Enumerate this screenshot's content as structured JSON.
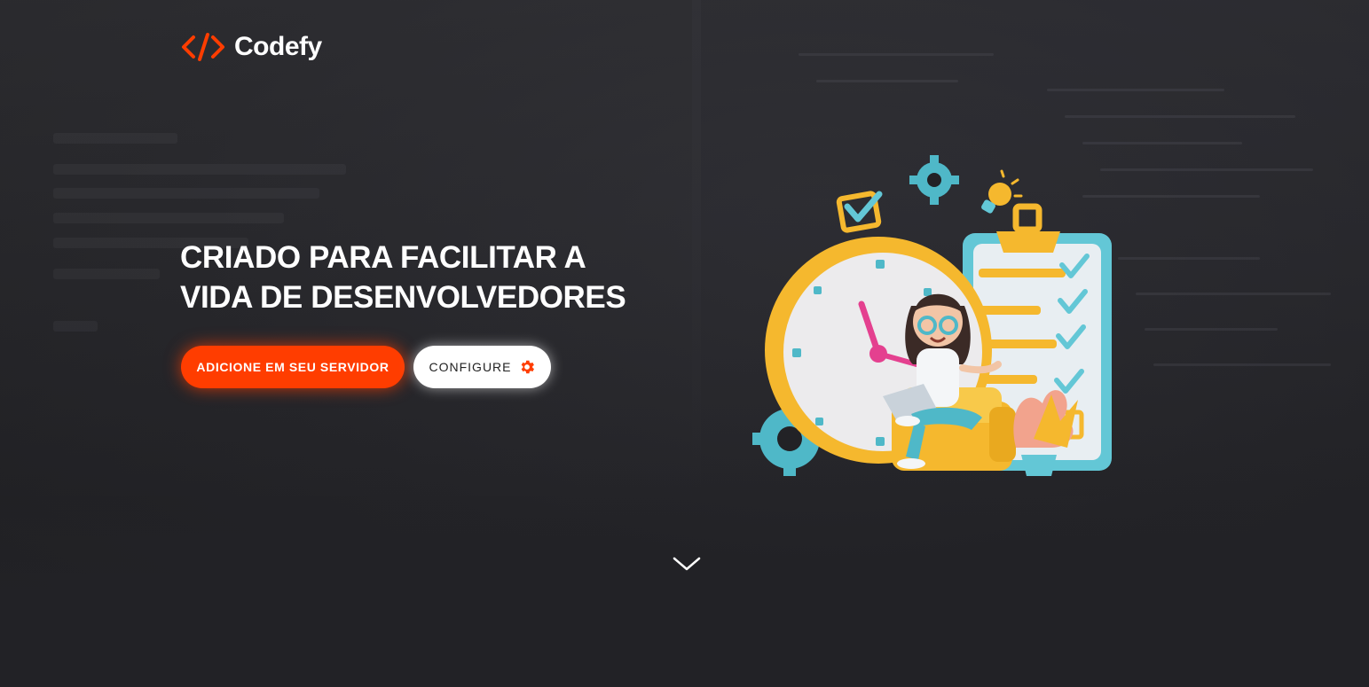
{
  "brand": {
    "name": "Codefy",
    "accent": "#ff3d00"
  },
  "hero": {
    "headline_line1": "CRIADO PARA FACILITAR A",
    "headline_line2": "VIDA DE DESENVOLVEDORES",
    "primary_button": "ADICIONE EM SEU SERVIDOR",
    "secondary_button": "CONFIGURE",
    "secondary_button_icon": "gear-icon"
  },
  "illustration": {
    "description_icon": "developer-clock-checklist-illustration"
  },
  "scroll": {
    "icon": "chevron-down-icon"
  }
}
